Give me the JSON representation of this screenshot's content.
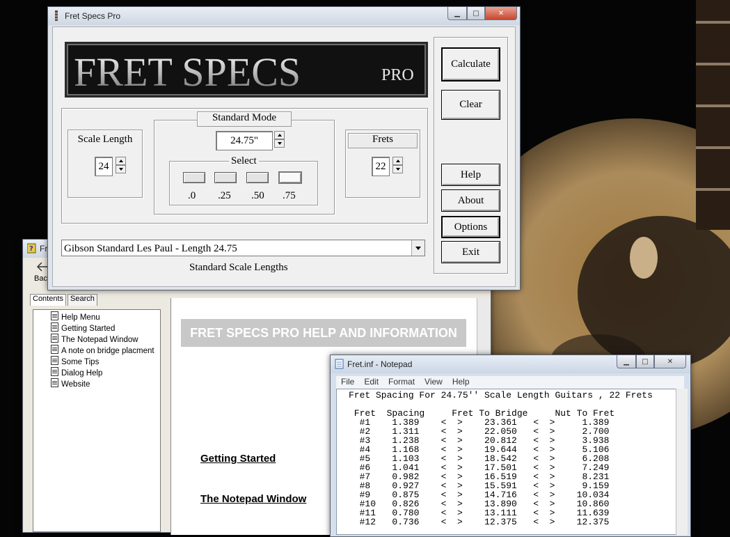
{
  "main_window": {
    "title": "Fret Specs Pro",
    "logo": {
      "main": "FRET SPECS",
      "suffix": "PRO"
    },
    "buttons": {
      "calculate": "Calculate",
      "clear": "Clear",
      "help": "Help",
      "about": "About",
      "options": "Options",
      "exit": "Exit"
    },
    "scale_length": {
      "label": "Scale Length",
      "value": "24"
    },
    "standard_mode": {
      "label": "Standard Mode",
      "value": "24.75\""
    },
    "select": {
      "label": "Select",
      "options": [
        ".0",
        ".25",
        ".50",
        ".75"
      ],
      "selected": ".75"
    },
    "frets": {
      "label": "Frets",
      "value": "22"
    },
    "scale_combo": {
      "value": "Gibson Standard  Les Paul - Length 24.75",
      "caption": "Standard Scale Lengths"
    }
  },
  "help_window": {
    "title_fragment": "Fr",
    "back_label": "Bac",
    "tabs": [
      "Contents",
      "Search"
    ],
    "tree": [
      "Help Menu",
      "Getting Started",
      "The Notepad Window",
      "A note on bridge placment",
      "Some Tips",
      "Dialog Help",
      "Website"
    ],
    "banner": "FRET SPECS PRO HELP AND INFORMATION",
    "links": [
      "Getting Started",
      "The Notepad Window"
    ]
  },
  "notepad_window": {
    "title": "Fret.inf - Notepad",
    "menu": [
      "File",
      "Edit",
      "Format",
      "View",
      "Help"
    ],
    "heading": "Fret Spacing For 24.75'' Scale Length Guitars , 22 Frets",
    "columns": [
      "Fret",
      "Spacing",
      "Fret To Bridge",
      "Nut To Fret"
    ],
    "rows": [
      [
        "#1",
        "1.389",
        "23.361",
        "1.389"
      ],
      [
        "#2",
        "1.311",
        "22.050",
        "2.700"
      ],
      [
        "#3",
        "1.238",
        "20.812",
        "3.938"
      ],
      [
        "#4",
        "1.168",
        "19.644",
        "5.106"
      ],
      [
        "#5",
        "1.103",
        "18.542",
        "6.208"
      ],
      [
        "#6",
        "1.041",
        "17.501",
        "7.249"
      ],
      [
        "#7",
        "0.982",
        "16.519",
        "8.231"
      ],
      [
        "#8",
        "0.927",
        "15.591",
        "9.159"
      ],
      [
        "#9",
        "0.875",
        "14.716",
        "10.034"
      ],
      [
        "#10",
        "0.826",
        "13.890",
        "10.860"
      ],
      [
        "#11",
        "0.780",
        "13.111",
        "11.639"
      ],
      [
        "#12",
        "0.736",
        "12.375",
        "12.375"
      ]
    ]
  },
  "icons": [
    "fret-specs-app-icon",
    "help-app-icon",
    "back-arrow-icon",
    "notepad-app-icon",
    "minimize-icon",
    "maximize-icon",
    "close-icon",
    "document-icon",
    "spin-up-icon",
    "spin-down-icon",
    "dropdown-arrow-icon"
  ],
  "colors": {
    "close_button": "#c7462b",
    "banner_bg": "#c8c8c8",
    "titlebar": "#cfd7e2",
    "desktop": "#050505"
  }
}
